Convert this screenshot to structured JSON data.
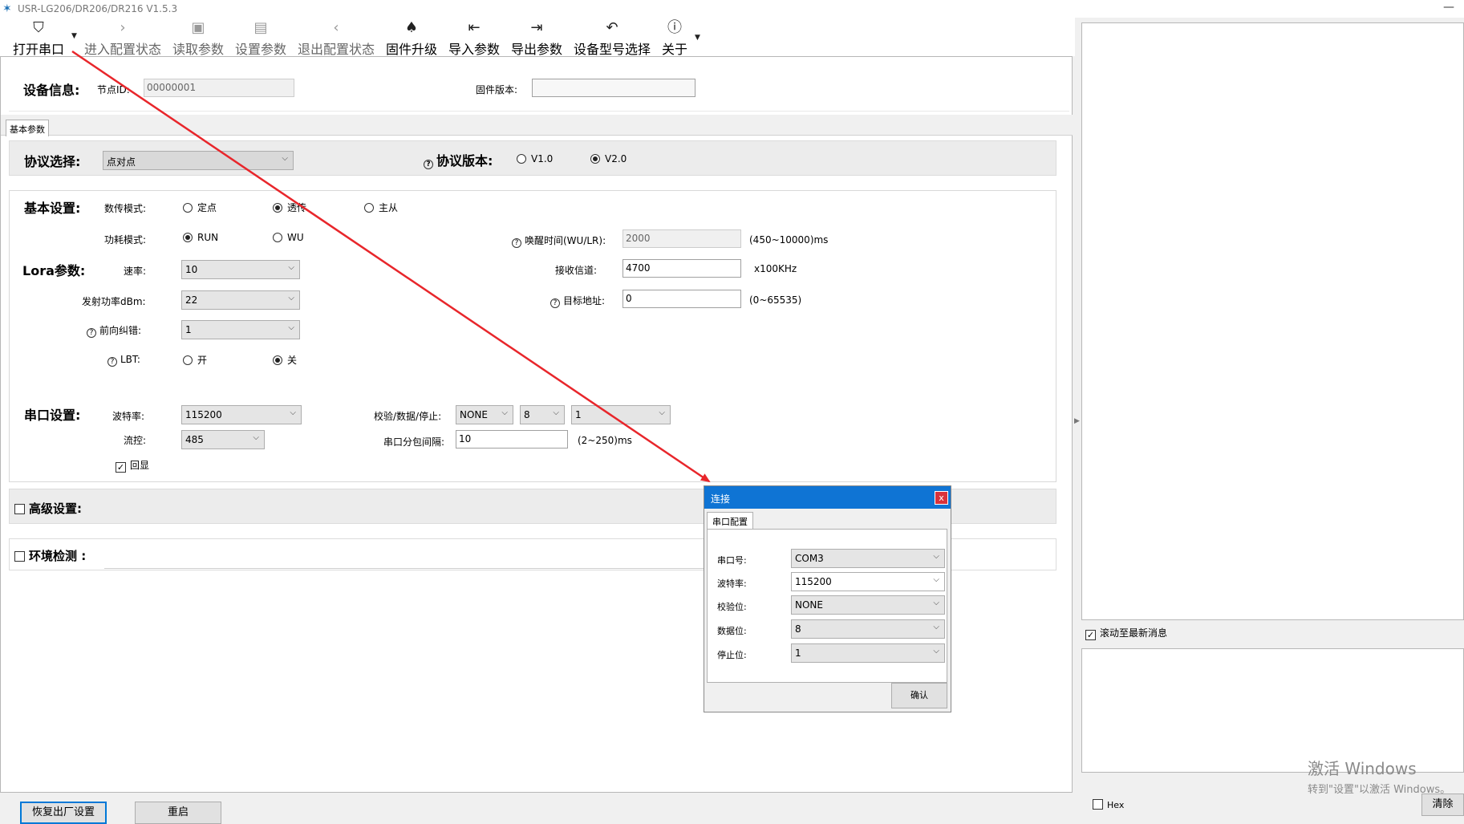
{
  "window": {
    "title": "USR-LG206/DR206/DR216 V1.5.3",
    "minimize": "—"
  },
  "toolbar": {
    "open_port": "打开串口",
    "enter_config": "进入配置状态",
    "read_params": "读取参数",
    "set_params": "设置参数",
    "exit_config": "退出配置状态",
    "firmware_upgrade": "固件升级",
    "import_params": "导入参数",
    "export_params": "导出参数",
    "device_model": "设备型号选择",
    "about": "关于"
  },
  "device_info": {
    "label": "设备信息:",
    "node_id_label": "节点ID:",
    "node_id_value": "00000001",
    "firmware_label": "固件版本:",
    "firmware_value": ""
  },
  "tabs": {
    "basic_params": "基本参数"
  },
  "protocol": {
    "label": "协议选择:",
    "value": "点对点",
    "version_label": "协议版本:",
    "v1": "V1.0",
    "v2": "V2.0"
  },
  "basic": {
    "label": "基本设置:",
    "mode_label": "数传模式:",
    "mode_fixed": "定点",
    "mode_transparent": "透传",
    "mode_master": "主从",
    "power_label": "功耗模式:",
    "power_run": "RUN",
    "power_wu": "WU",
    "wake_label": "唤醒时间(WU/LR):",
    "wake_value": "2000",
    "wake_range": "(450~10000)ms"
  },
  "lora": {
    "label": "Lora参数:",
    "rate_label": "速率:",
    "rate_value": "10",
    "tx_power_label": "发射功率dBm:",
    "tx_power_value": "22",
    "fec_label": "前向纠错:",
    "fec_value": "1",
    "lbt_label": "LBT:",
    "lbt_on": "开",
    "lbt_off": "关",
    "channel_label": "接收信道:",
    "channel_value": "4700",
    "channel_unit": "x100KHz",
    "target_label": "目标地址:",
    "target_value": "0",
    "target_range": "(0~65535)"
  },
  "serial": {
    "label": "串口设置:",
    "baud_label": "波特率:",
    "baud_value": "115200",
    "flow_label": "流控:",
    "flow_value": "485",
    "echo_label": "回显",
    "check_label": "校验/数据/停止:",
    "parity_value": "NONE",
    "data_value": "8",
    "stop_value": "1",
    "interval_label": "串口分包间隔:",
    "interval_value": "10",
    "interval_range": "(2~250)ms"
  },
  "advanced": {
    "label": "高级设置:"
  },
  "environment": {
    "label": "环境检测 :"
  },
  "right": {
    "scroll_label": "滚动至最新消息",
    "hex_label": "Hex",
    "clear_button": "清除"
  },
  "bottom": {
    "factory_reset": "恢复出厂设置",
    "restart": "重启"
  },
  "dialog": {
    "title": "连接",
    "close": "x",
    "tab": "串口配置",
    "port_label": "串口号:",
    "port_value": "COM3",
    "baud_label": "波特率:",
    "baud_value": "115200",
    "parity_label": "校验位:",
    "parity_value": "NONE",
    "data_label": "数据位:",
    "data_value": "8",
    "stop_label": "停止位:",
    "stop_value": "1",
    "confirm": "确认"
  },
  "watermark": {
    "line1": "激活 Windows",
    "line2": "转到\"设置\"以激活 Windows。"
  },
  "colors": {
    "accent": "#0f74d4",
    "arrow": "#e8262b",
    "close": "#d8323b"
  }
}
